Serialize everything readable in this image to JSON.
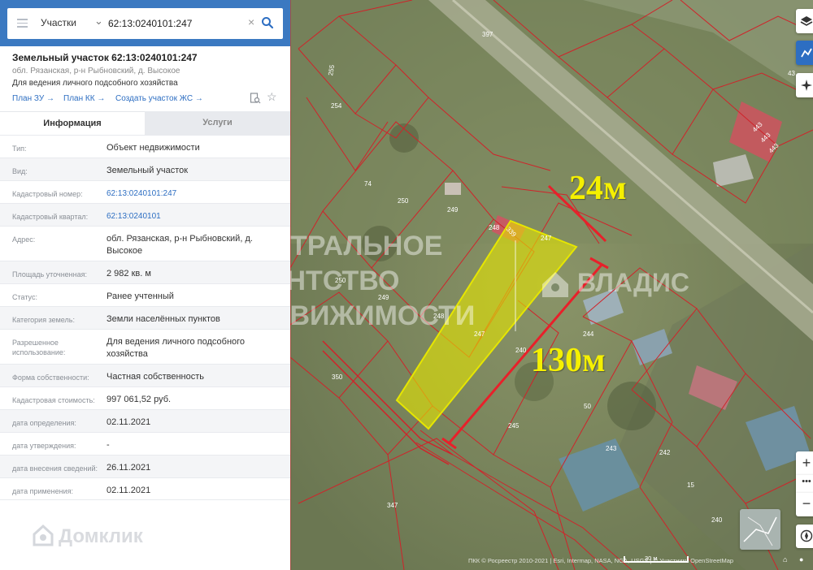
{
  "search": {
    "category": "Участки",
    "value": "62:13:0240101:247"
  },
  "object": {
    "title": "Земельный участок 62:13:0240101:247",
    "address": "обл. Рязанская, р-н Рыбновский, д. Высокое",
    "usage": "Для ведения личного подсобного хозяйства",
    "links": [
      "План ЗУ →",
      "План КК →",
      "Создать участок ЖС →"
    ]
  },
  "tabs": [
    "Информация",
    "Услуги"
  ],
  "rows": [
    {
      "label": "Тип:",
      "value": "Объект недвижимости"
    },
    {
      "label": "Вид:",
      "value": "Земельный участок"
    },
    {
      "label": "Кадастровый номер:",
      "value": "62:13:0240101:247"
    },
    {
      "label": "Кадастровый квартал:",
      "value": "62:13:0240101"
    },
    {
      "label": "Адрес:",
      "value": "обл. Рязанская, р-н Рыбновский, д. Высокое"
    },
    {
      "label": "Площадь уточненная:",
      "value": "2 982 кв. м"
    },
    {
      "label": "Статус:",
      "value": "Ранее учтенный"
    },
    {
      "label": "Категория земель:",
      "value": "Земли населённых пунктов"
    },
    {
      "label": "Разрешенное использование:",
      "value": "Для ведения личного подсобного хозяйства"
    },
    {
      "label": "Форма собственности:",
      "value": "Частная собственность"
    },
    {
      "label": "Кадастровая стоимость:",
      "value": "997 061,52 руб."
    },
    {
      "label": "дата определения:",
      "value": "02.11.2021"
    },
    {
      "label": "дата утверждения:",
      "value": "-"
    },
    {
      "label": "дата внесения сведений:",
      "value": "26.11.2021"
    },
    {
      "label": "дата применения:",
      "value": "02.11.2021"
    }
  ],
  "watermarks": {
    "domclick": "Домклик",
    "agency_line1": "ЦЕНТРАЛЬНОЕ",
    "agency_line2": "АГЕНТСТВО",
    "agency_line3": "НЕДВИЖИМОСТИ",
    "vladis": "ВЛАДИС"
  },
  "map": {
    "dimension_width": "24м",
    "dimension_length": "130м",
    "parcel_labels": [
      "397",
      "255",
      "254",
      "74",
      "250",
      "249",
      "248",
      "339",
      "247",
      "250",
      "249",
      "248",
      "247",
      "240",
      "244",
      "350",
      "50",
      "245",
      "243",
      "242",
      "15",
      "347",
      "240",
      "443",
      "443",
      "443",
      "43"
    ],
    "scale": "30 м",
    "attribution": "ПКК © Росреестр 2010-2021 | Esri, Intermap, NASA, NGA, USGS | © Участники OpenStreetMap",
    "selected_color": "#e6e600",
    "boundary_color": "#d0232a"
  }
}
